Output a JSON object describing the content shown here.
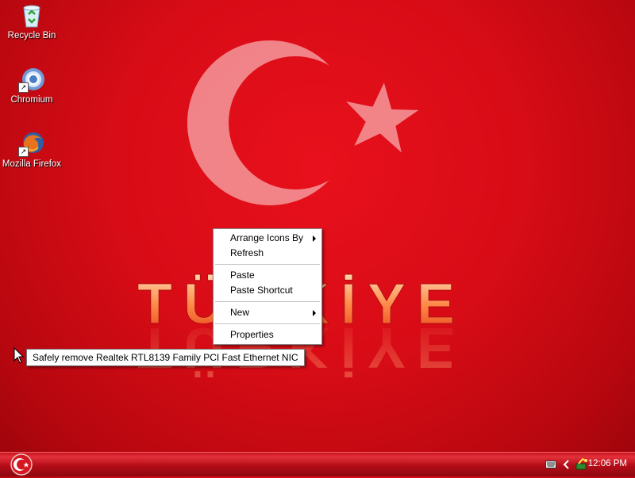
{
  "desktop": {
    "icons": [
      {
        "label": "Recycle Bin",
        "icon": "recycle-bin-icon"
      },
      {
        "label": "Chromium",
        "icon": "chromium-icon"
      },
      {
        "label": "Mozilla Firefox",
        "icon": "firefox-icon"
      }
    ],
    "wallpaper": {
      "text": "TÜRKİYE",
      "colors": {
        "background": "#d80c16",
        "emblem": "#f2a0a2"
      }
    }
  },
  "context_menu": {
    "items": [
      {
        "label": "Arrange Icons By",
        "submenu": true
      },
      {
        "label": "Refresh"
      },
      {
        "label": "Paste"
      },
      {
        "label": "Paste Shortcut"
      },
      {
        "label": "New",
        "submenu": true
      },
      {
        "label": "Properties"
      }
    ]
  },
  "tooltip": {
    "text": "Safely remove Realtek RTL8139 Family PCI Fast Ethernet NIC"
  },
  "taskbar": {
    "start_icon": "crescent-star-logo-icon",
    "tray_icons": [
      "keyboard-icon",
      "chevron-left-icon",
      "network-hardware-icon"
    ],
    "clock": "12:06 PM"
  }
}
